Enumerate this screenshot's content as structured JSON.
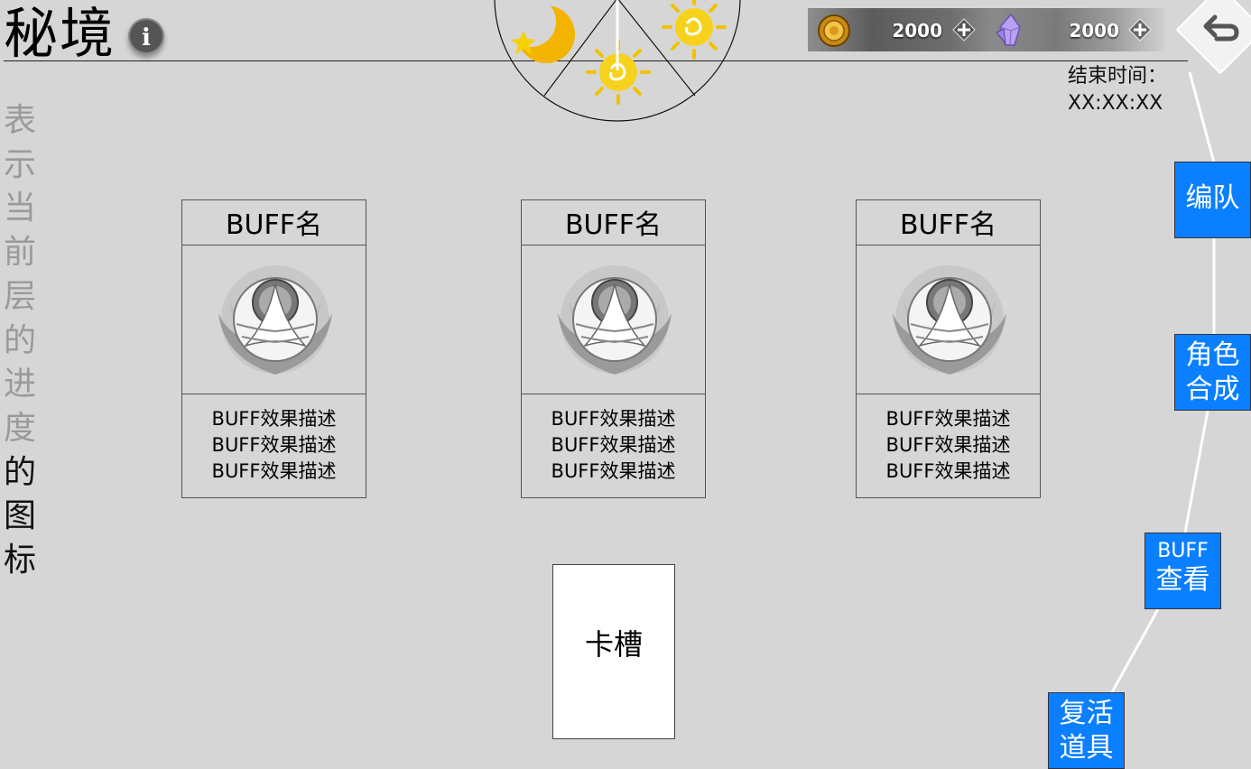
{
  "header": {
    "title": "秘境",
    "info_icon": "info-icon",
    "info_glyph": "i"
  },
  "progress": {
    "chars_dim": [
      "表",
      "示",
      "当",
      "前",
      "层",
      "的",
      "进",
      "度"
    ],
    "chars_dark": [
      "的",
      "图",
      "标"
    ]
  },
  "currency": {
    "gold": {
      "icon": "gold-coin-icon",
      "value": "2000"
    },
    "crystal": {
      "icon": "crystal-icon",
      "value": "2000"
    },
    "add_icon": "plus-icon"
  },
  "back": {
    "icon": "back-arrow-icon"
  },
  "end_time": {
    "label": "结束时间：",
    "value": "XX:XX:XX"
  },
  "dial": {
    "icons": [
      "moon-icon",
      "sun-icon",
      "sun-icon"
    ]
  },
  "buff_cards": [
    {
      "name": "BUFF名",
      "icon": "phoenix-emblem-icon",
      "desc": [
        "BUFF效果描述",
        "BUFF效果描述",
        "BUFF效果描述"
      ]
    },
    {
      "name": "BUFF名",
      "icon": "phoenix-emblem-icon",
      "desc": [
        "BUFF效果描述",
        "BUFF效果描述",
        "BUFF效果描述"
      ]
    },
    {
      "name": "BUFF名",
      "icon": "phoenix-emblem-icon",
      "desc": [
        "BUFF效果描述",
        "BUFF效果描述",
        "BUFF效果描述"
      ]
    }
  ],
  "card_slot": {
    "label": "卡槽"
  },
  "side_buttons": {
    "team": "编队",
    "compose": [
      "角色",
      "合成"
    ],
    "buff_view": [
      "BUFF",
      "查看"
    ],
    "revive": [
      "复活",
      "道具"
    ]
  },
  "colors": {
    "background": "#d6d6d6",
    "side_button": "#0a7fff",
    "sun": "#f2c200"
  }
}
